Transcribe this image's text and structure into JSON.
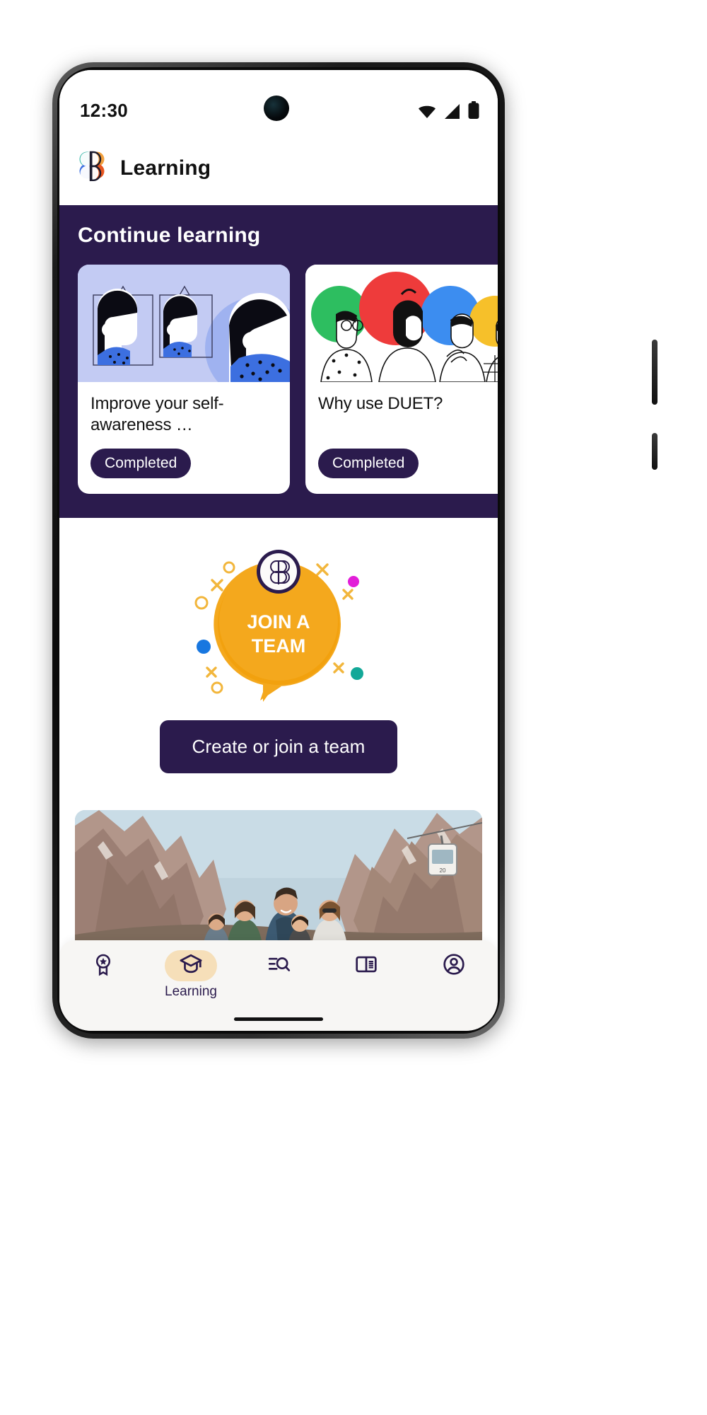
{
  "status_bar": {
    "time": "12:30",
    "icons": [
      "wifi-icon",
      "cellular-signal-icon",
      "battery-icon"
    ]
  },
  "app_bar": {
    "logo": "betterup-logo-icon",
    "title": "Learning"
  },
  "continue_learning": {
    "heading": "Continue learning",
    "background_color": "#2B1B4D",
    "courses": [
      {
        "title": "Improve your self-awareness …",
        "badge": "Completed",
        "thumbnail": "mirrors-illustration",
        "thumb_bg": "#C3CBF3"
      },
      {
        "title": "Why use DUET?",
        "badge": "Completed",
        "thumbnail": "people-circles-illustration",
        "thumb_bg": "#FFFFFF"
      }
    ]
  },
  "team_section": {
    "illustration": "join-a-team-badge-illustration",
    "bubble_line1": "JOIN A",
    "bubble_line2": "TEAM",
    "bubble_color": "#F4A81D",
    "monogram": "BB",
    "cta_label": "Create or join a team",
    "cta_color": "#2B1B4D"
  },
  "photo_card": {
    "alt": "mountain-hikers-photo"
  },
  "bottom_nav": {
    "active_index": 1,
    "items": [
      {
        "icon": "award-badge-icon",
        "label": ""
      },
      {
        "icon": "graduation-cap-icon",
        "label": "Learning"
      },
      {
        "icon": "search-list-icon",
        "label": ""
      },
      {
        "icon": "book-open-icon",
        "label": ""
      },
      {
        "icon": "account-circle-icon",
        "label": ""
      }
    ]
  }
}
